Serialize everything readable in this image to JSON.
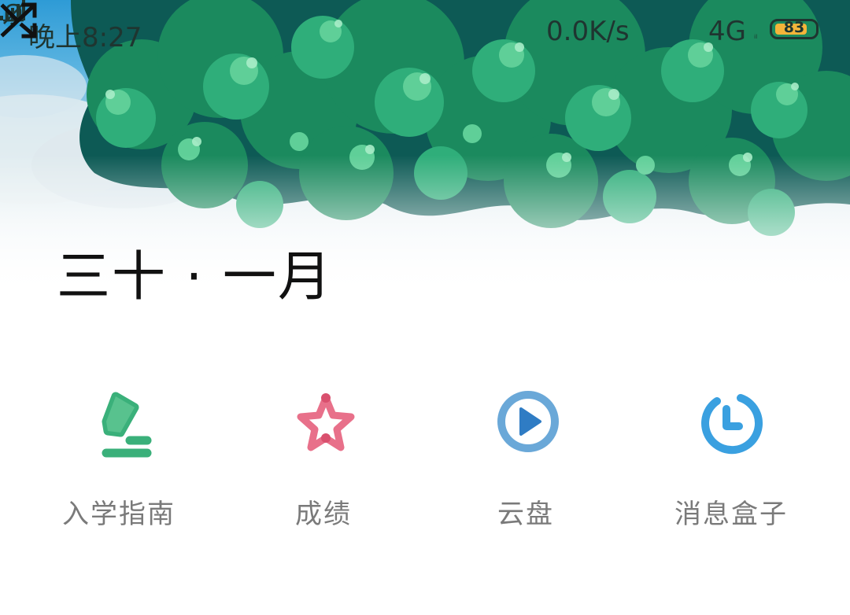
{
  "status_bar": {
    "time": "晚上8:27",
    "net_speed": "0.0K/s",
    "net_type": "4G",
    "lte_mark": "ᵢₗ",
    "battery": "83",
    "icons": [
      "qq-icon",
      "bell-off-icon",
      "signal-icon",
      "battery-icon"
    ]
  },
  "banner": {
    "title": "三十 · 一月",
    "shuffle_icon": "shuffle-icon"
  },
  "grid": {
    "items": [
      {
        "label": "入学指南",
        "icon": "guide-icon",
        "color": "#3ab07a"
      },
      {
        "label": "成绩",
        "icon": "star-icon",
        "color": "#e8708a"
      },
      {
        "label": "云盘",
        "icon": "play-circle-icon",
        "color": "#4a8fd0"
      },
      {
        "label": "消息盒子",
        "icon": "clock-icon",
        "color": "#3aa0e0"
      }
    ]
  }
}
